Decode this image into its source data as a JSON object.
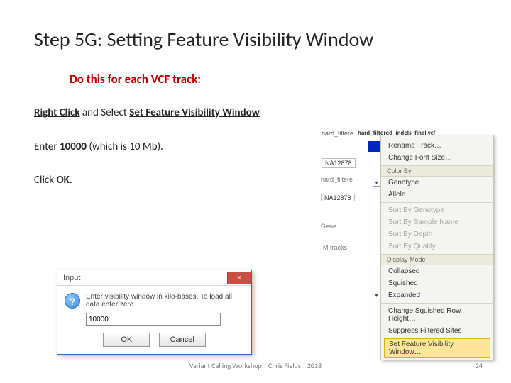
{
  "title": "Step 5G: Setting Feature Visibility Window",
  "subhead": "Do this for each VCF track:",
  "step1_a": "Right Click",
  "step1_b": " and Select ",
  "step1_c": "Set Feature Visibility Window",
  "step2_a": "Enter ",
  "step2_b": "10000",
  "step2_c": " (which is 10 Mb).",
  "step3_a": "Click ",
  "step3_b": "OK.",
  "track": {
    "label_top": "hard_filtere",
    "bar_label": "hard_filtered_indels_final.vcf",
    "badge": "NA12878"
  },
  "ghosts": {
    "a": "hard_filtere",
    "b": "NA12878",
    "c": "Gene",
    "d": "-M tracks"
  },
  "menu": {
    "rename": "Rename Track…",
    "font": "Change Font Size…",
    "sect_colorby": "Color By",
    "genotype": "Genotype",
    "allele": "Allele",
    "sort_gen": "Sort By Genotype",
    "sort_samp": "Sort By Sample Name",
    "sort_depth": "Sort By Depth",
    "sort_qual": "Sort By Quality",
    "sect_display": "Display Mode",
    "collapsed": "Collapsed",
    "squished": "Squished",
    "expanded": "Expanded",
    "row_h": "Change Squished Row Height…",
    "suppress": "Suppress Filtered Sites",
    "setvis": "Set Feature Visibility Window…"
  },
  "dialog": {
    "title": "Input",
    "msg": "Enter visibility window in kilo-bases. To load all data enter zero.",
    "value": "10000",
    "ok": "OK",
    "cancel": "Cancel"
  },
  "footer": "Variant Calling Workshop | Chris Fields | 2018",
  "page": "24"
}
